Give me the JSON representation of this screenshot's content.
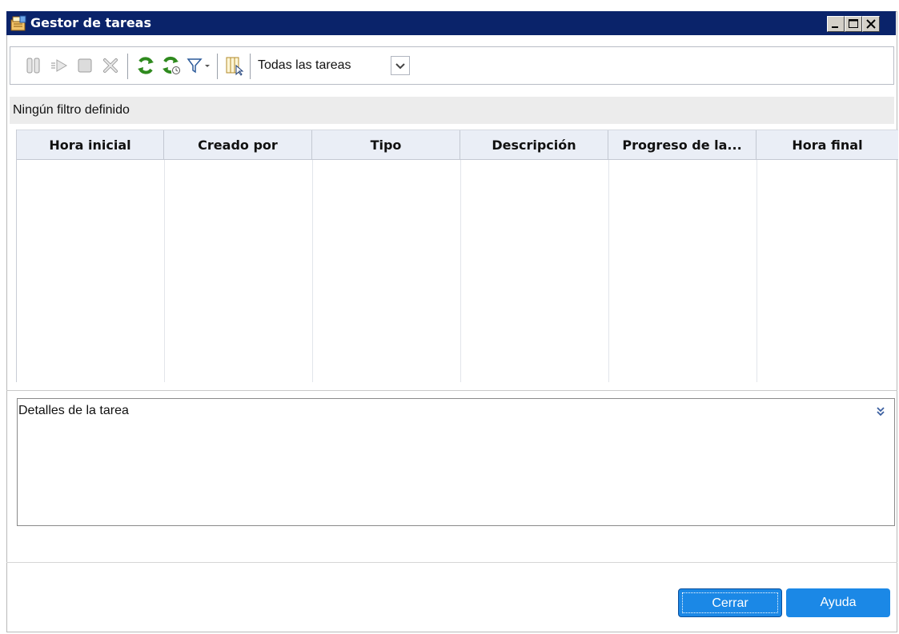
{
  "window": {
    "title": "Gestor de tareas",
    "title_icon": "task-manager-icon"
  },
  "title_controls": {
    "minimize_icon": "minimize-icon",
    "maximize_icon": "maximize-icon",
    "close_icon": "close-icon"
  },
  "toolbar": {
    "icons": [
      "pause-icon",
      "resume-icon",
      "stop-icon",
      "delete-icon",
      "refresh-icon",
      "auto-refresh-icon",
      "filter-icon",
      "filter-dropdown-icon",
      "columns-icon"
    ],
    "view_select_value": "Todas las tareas",
    "view_dropdown_icon": "chevron-down-icon"
  },
  "filter_status": "Ningún filtro definido",
  "table": {
    "columns": [
      "Hora inicial",
      "Creado por",
      "Tipo",
      "Descripción",
      "Progreso de la...",
      "Hora final"
    ],
    "rows": []
  },
  "details": {
    "label": "Detalles de la tarea",
    "expand_icon": "double-chevron-down-icon"
  },
  "buttons": {
    "close_label": "Cerrar",
    "help_label": "Ayuda"
  },
  "colors": {
    "titlebar": "#0a236a",
    "button_accent": "#1b88e6",
    "refresh_green": "#2f8a1e"
  }
}
